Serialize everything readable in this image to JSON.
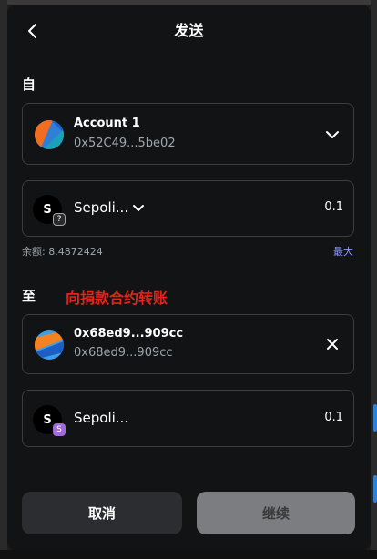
{
  "header": {
    "title": "发送"
  },
  "from": {
    "label": "自",
    "account_name": "Account 1",
    "address": "0x52C49...5be02"
  },
  "asset": {
    "token_initial": "S",
    "token_name": "Sepoli...",
    "amount": "0.1",
    "balance_text": "余额: 8.4872424",
    "max_label": "最大"
  },
  "to": {
    "label": "至",
    "note": "向捐款合约转账",
    "recipient_name": "0x68ed9...909cc",
    "recipient_address": "0x68ed9...909cc"
  },
  "receive": {
    "token_initial": "S",
    "badge": "S",
    "token_name": "Sepoli...",
    "amount": "0.1"
  },
  "footer": {
    "cancel_label": "取消",
    "continue_label": "继续"
  },
  "colors": {
    "background": "#121314",
    "accent_link": "#8b99ff",
    "note_red": "#e4231b",
    "network_badge": "#a06ad7"
  }
}
